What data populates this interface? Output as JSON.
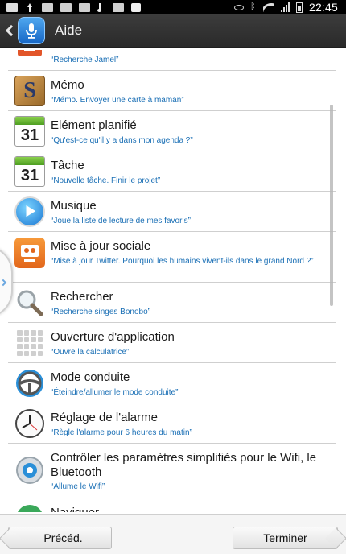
{
  "statusbar": {
    "time": "22:45"
  },
  "actionbar": {
    "back_icon": "chevron-left-icon",
    "app_icon": "microphone-icon",
    "title": "Aide"
  },
  "list": {
    "partial_top": {
      "subtitle": "“Recherche Jamel”",
      "icon": "contact-icon"
    },
    "items": [
      {
        "title": "Mémo",
        "subtitle": "“Mémo. Envoyer une carte à maman”",
        "icon": "memo-icon"
      },
      {
        "title": "Elément planifié",
        "subtitle": "“Qu'est-ce qu'il y a dans mon agenda ?”",
        "icon": "calendar-icon",
        "icon_text": "31"
      },
      {
        "title": "Tâche",
        "subtitle": "“Nouvelle tâche. Finir le projet”",
        "icon": "calendar-icon",
        "icon_text": "31"
      },
      {
        "title": "Musique",
        "subtitle": "“Joue la liste de lecture de mes favoris”",
        "icon": "music-icon"
      },
      {
        "title": "Mise à jour sociale",
        "subtitle": "“Mise à jour Twitter. Pourquoi les humains vivent-ils dans le grand Nord ?”",
        "icon": "social-icon"
      },
      {
        "title": "Rechercher",
        "subtitle": "“Recherche singes Bonobo”",
        "icon": "search-icon"
      },
      {
        "title": "Ouverture d'application",
        "subtitle": "“Ouvre la calculatrice”",
        "icon": "calculator-icon"
      },
      {
        "title": "Mode conduite",
        "subtitle": "“Éteindre/allumer le mode conduite”",
        "icon": "steering-wheel-icon"
      },
      {
        "title": "Réglage de l'alarme",
        "subtitle": "“Règle l'alarme pour 6 heures du matin”",
        "icon": "clock-icon"
      },
      {
        "title": "Contrôler les paramètres simplifiés pour le Wifi, le Bluetooth",
        "subtitle": "“Allume le Wifi”",
        "icon": "settings-icon"
      },
      {
        "title": "Naviguer",
        "subtitle": "",
        "icon": "navigation-icon"
      }
    ]
  },
  "bottombar": {
    "prev_label": "Précéd.",
    "done_label": "Terminer"
  },
  "colors": {
    "accent": "#1a6fb5",
    "actionbar": "#333333"
  }
}
